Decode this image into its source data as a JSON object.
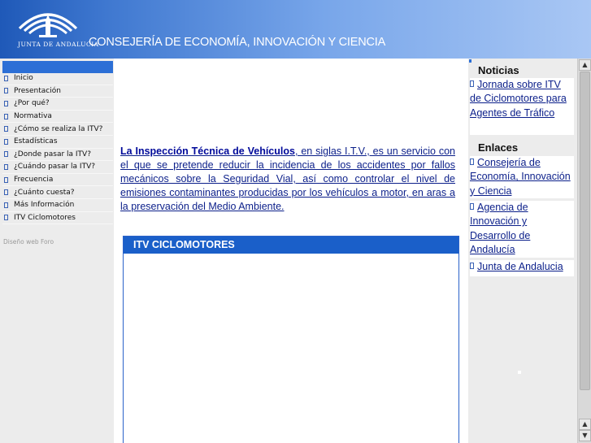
{
  "header": {
    "logo_text": "JUNTA DE ANDALUCIA",
    "title": "CONSEJERÍA DE ECONOMÍA, INNOVACIÓN Y CIENCIA"
  },
  "sidebar": {
    "items": [
      {
        "label": "Inicio"
      },
      {
        "label": "Presentación"
      },
      {
        "label": "¿Por qué?"
      },
      {
        "label": "Normativa"
      },
      {
        "label": "¿Cómo se realiza la ITV?"
      },
      {
        "label": "Estadísticas"
      },
      {
        "label": "¿Donde pasar la ITV?"
      },
      {
        "label": "¿Cuándo pasar la ITV?"
      },
      {
        "label": "Frecuencia"
      },
      {
        "label": "¿Cuánto cuesta?"
      },
      {
        "label": "Más Información"
      },
      {
        "label": "ITV Ciclomotores"
      }
    ],
    "footer": "Diseño web Foro"
  },
  "main": {
    "intro_lead": "La Inspección Técnica de Vehículos",
    "intro_rest": ", en siglas I.T.V., es un servicio con el que se pretende reducir la incidencia de los accidentes por fallos mecánicos sobre la Seguridad Vial, así como controlar el nivel de emisiones contaminantes producidas por los vehículos a motor, en aras a la preservación del Medio Ambiente.",
    "itv_box_title": "ITV CICLOMOTORES"
  },
  "right": {
    "noticias_title": "Noticias",
    "noticias_link": "Jornada sobre ITV de Ciclomotores para Agentes de Tráfico",
    "enlaces_title": "Enlaces",
    "enlaces": [
      {
        "label": "Consejería de Economía, Innovación y Ciencia"
      },
      {
        "label": "Agencia de Innovación y Desarrollo de Andalucía"
      },
      {
        "label": "Junta de Andalucia"
      }
    ]
  },
  "colors": {
    "accent": "#1a5fc9",
    "link": "#0b1f8a"
  }
}
